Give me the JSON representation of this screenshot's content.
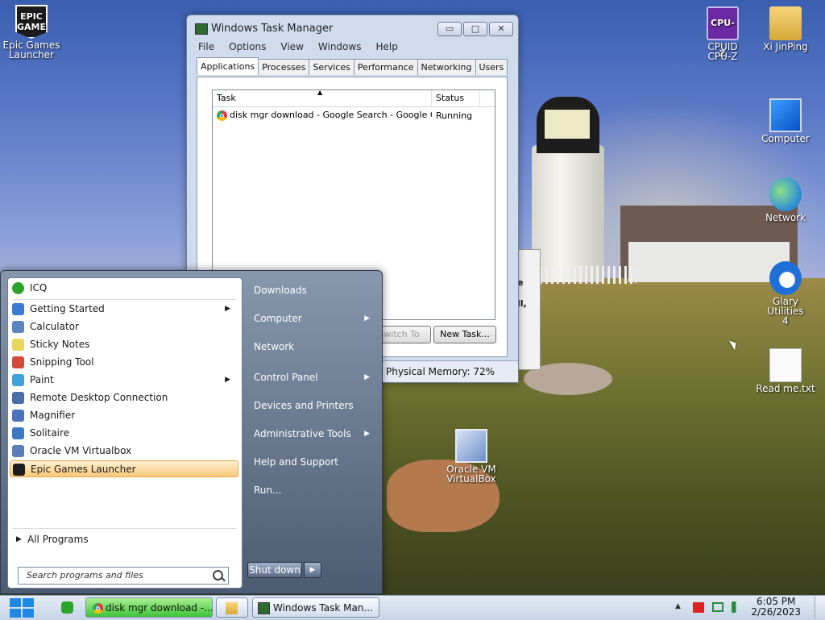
{
  "desktop": {
    "icons": [
      {
        "label_line1": "Epic Games",
        "label_line2": "Launcher",
        "glyph": "EPIC GAMES"
      },
      {
        "label_line1": "CPUID",
        "label_line2": "CPU-Z",
        "glyph": "CPU-Z"
      },
      {
        "label_line1": "Xi JinPing",
        "label_line2": ""
      },
      {
        "label_line1": "Computer",
        "label_line2": ""
      },
      {
        "label_line1": "Network",
        "label_line2": ""
      },
      {
        "label_line1": "Glary Utilities",
        "label_line2": "4"
      },
      {
        "label_line1": "Read me.txt",
        "label_line2": ""
      },
      {
        "label_line1": "Oracle VM",
        "label_line2": "VirtualBox"
      }
    ]
  },
  "task_manager": {
    "title": "Windows Task Manager",
    "menu": [
      "File",
      "Options",
      "View",
      "Windows",
      "Help"
    ],
    "window_buttons": {
      "minimize": "▭",
      "maximize": "□",
      "close": "✕"
    },
    "tabs": [
      "Applications",
      "Processes",
      "Services",
      "Performance",
      "Networking",
      "Users"
    ],
    "active_tab": "Applications",
    "columns": {
      "task": "Task",
      "status": "Status"
    },
    "rows": [
      {
        "task": "disk mgr download - Google Search - Google Chr...",
        "status": "Running"
      }
    ],
    "buttons": {
      "switch_to": "Switch To",
      "new_task": "New Task..."
    },
    "status_memory": "Physical Memory: 72%"
  },
  "background_window": {
    "line1": "e",
    "line2": "ll,"
  },
  "start_menu": {
    "left_items": [
      {
        "label": "ICQ",
        "icon": "icq-flower-icon",
        "color": "#2aa52a",
        "submenu": false
      },
      {
        "label": "Getting Started",
        "icon": "getting-started-icon",
        "color": "#3b7bd6",
        "submenu": true
      },
      {
        "label": "Calculator",
        "icon": "calculator-icon",
        "color": "#5b86c2",
        "submenu": false
      },
      {
        "label": "Sticky Notes",
        "icon": "sticky-notes-icon",
        "color": "#e9d65c",
        "submenu": false
      },
      {
        "label": "Snipping Tool",
        "icon": "scissors-icon",
        "color": "#d24a3a",
        "submenu": false
      },
      {
        "label": "Paint",
        "icon": "paint-icon",
        "color": "#3fa2d8",
        "submenu": true
      },
      {
        "label": "Remote Desktop Connection",
        "icon": "remote-desktop-icon",
        "color": "#4a6ea8",
        "submenu": false
      },
      {
        "label": "Magnifier",
        "icon": "magnifier-icon",
        "color": "#4b74b8",
        "submenu": false
      },
      {
        "label": "Solitaire",
        "icon": "cards-icon",
        "color": "#3b79c7",
        "submenu": false
      },
      {
        "label": "Oracle VM Virtualbox",
        "icon": "virtualbox-icon",
        "color": "#5b7fb8",
        "submenu": false
      },
      {
        "label": "Epic Games Launcher",
        "icon": "epic-games-icon",
        "color": "#1c1c1c",
        "submenu": false
      }
    ],
    "all_programs": "All Programs",
    "search_placeholder": "Search programs and files",
    "right_items": [
      {
        "label": "Downloads",
        "submenu": false
      },
      {
        "label": "Computer",
        "submenu": true
      },
      {
        "label": "Network",
        "submenu": false
      },
      {
        "label": "Control Panel",
        "submenu": true
      },
      {
        "label": "Devices and Printers",
        "submenu": false
      },
      {
        "label": "Administrative Tools",
        "submenu": true
      },
      {
        "label": "Help and Support",
        "submenu": false
      },
      {
        "label": "Run...",
        "submenu": false
      }
    ],
    "shutdown": "Shut down",
    "shutdown_arrow": "▶"
  },
  "taskbar": {
    "buttons": [
      {
        "label": "disk mgr download -...",
        "icon": "chrome-icon",
        "active": true
      },
      {
        "label": "",
        "icon": "folder-icon",
        "active": false
      },
      {
        "label": "Windows Task Man...",
        "icon": "task-manager-icon",
        "active": false
      }
    ],
    "clock_time": "6:05 PM",
    "clock_date": "2/26/2023",
    "tray_icons": [
      "show-hidden-icon",
      "action-center-flag-icon",
      "network-icon",
      "volume-icon"
    ],
    "tray_up_arrow": "▲"
  },
  "colors": {
    "highlight": "#f9c97a",
    "taskbar_active": "#3fc33a",
    "win_accent": "#1e88e5"
  }
}
